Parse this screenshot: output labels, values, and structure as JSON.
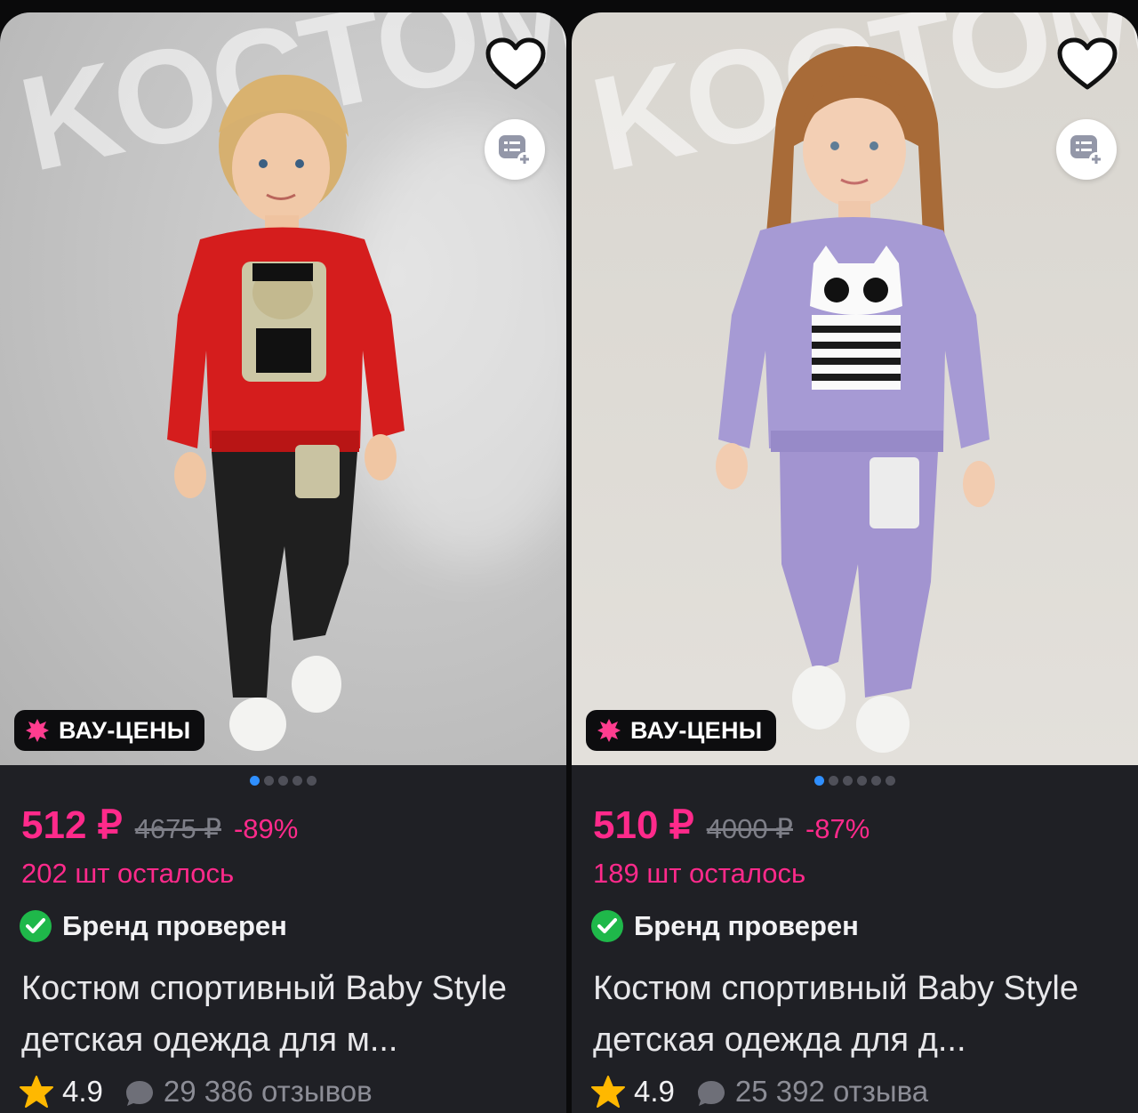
{
  "products": [
    {
      "id": "boy",
      "watermark": "KOCTOM",
      "promo_label": "ВАУ-ЦЕНЫ",
      "price": "512 ₽",
      "old_price": "4675 ₽",
      "discount": "-89%",
      "stock": "202 шт осталось",
      "brand_status": "Бренд проверен",
      "title": "Костюм спортивный Baby Style детская одежда для м...",
      "rating": "4.9",
      "reviews": "29 386 отзывов",
      "gallery_total": 5,
      "gallery_active": 0
    },
    {
      "id": "girl",
      "watermark": "KOCTOM",
      "promo_label": "ВАУ-ЦЕНЫ",
      "price": "510 ₽",
      "old_price": "4000 ₽",
      "discount": "-87%",
      "stock": "189 шт осталось",
      "brand_status": "Бренд проверен",
      "title": "Костюм спортивный Baby Style детская одежда для д...",
      "rating": "4.9",
      "reviews": "25 392 отзыва",
      "gallery_total": 6,
      "gallery_active": 0
    }
  ],
  "icons": {
    "favorite": "heart-icon",
    "compare": "compare-list-icon",
    "promo": "sale-burst-icon",
    "verified": "check-circle-icon",
    "rating": "star-icon",
    "reviews": "chat-bubble-icon"
  },
  "colors": {
    "accent": "#ff2a8b",
    "card_bg": "#1f2025",
    "verified": "#1fb84a",
    "star": "#ffb800",
    "dot_active": "#2f8fff"
  }
}
